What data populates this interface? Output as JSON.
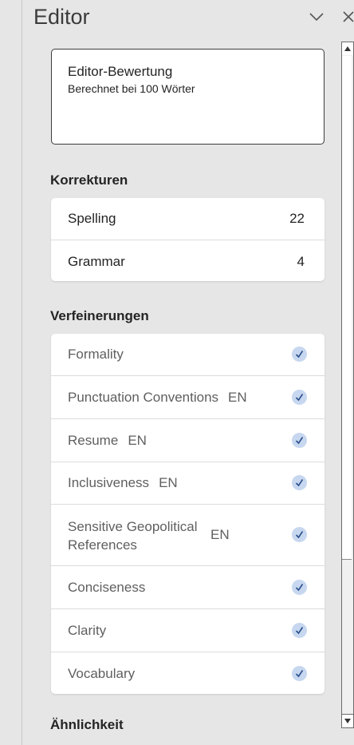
{
  "pane": {
    "title": "Editor"
  },
  "score": {
    "title": "Editor-Bewertung",
    "subtitle": "Berechnet bei 100 Wörter"
  },
  "corrections": {
    "heading": "Korrekturen",
    "items": [
      {
        "label": "Spelling",
        "count": "22"
      },
      {
        "label": "Grammar",
        "count": "4"
      }
    ]
  },
  "refinements": {
    "heading": "Verfeinerungen",
    "items": [
      {
        "label": "Formality",
        "lang": ""
      },
      {
        "label": "Punctuation Conventions",
        "lang": "EN"
      },
      {
        "label": "Resume",
        "lang": "EN"
      },
      {
        "label": "Inclusiveness",
        "lang": "EN"
      },
      {
        "label": "Sensitive Geopolitical\nReferences",
        "lang": "EN"
      },
      {
        "label": "Conciseness",
        "lang": ""
      },
      {
        "label": "Clarity",
        "lang": ""
      },
      {
        "label": "Vocabulary",
        "lang": ""
      }
    ]
  },
  "similarity": {
    "heading": "Ähnlichkeit"
  },
  "colors": {
    "check_bg": "#c7d7ef",
    "check_mark": "#2a4f8a"
  }
}
